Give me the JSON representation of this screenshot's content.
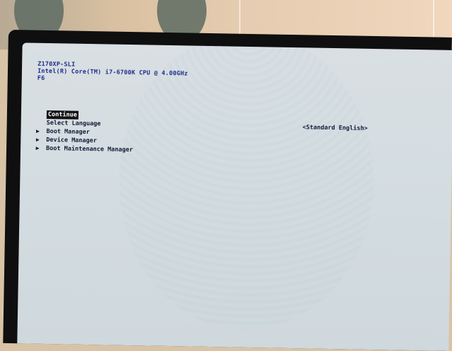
{
  "header": {
    "line1": "Z170XP-SLI",
    "line2": "Intel(R) Core(TM) i7-6700K CPU @ 4.00GHz",
    "line3": "F6"
  },
  "menu": {
    "items": [
      {
        "label": "Continue",
        "arrow": ""
      },
      {
        "label": "Select Language",
        "arrow": ""
      },
      {
        "label": "Boot Manager",
        "arrow": "▶"
      },
      {
        "label": "Device Manager",
        "arrow": "▶"
      },
      {
        "label": "Boot Maintenance Manager",
        "arrow": "▶"
      }
    ]
  },
  "language": {
    "value": "<Standard English>"
  },
  "colors": {
    "screen": "#d4dde1",
    "text": "#1b2f8a",
    "selected_bg": "#111111",
    "bezel": "#0f0f10"
  }
}
